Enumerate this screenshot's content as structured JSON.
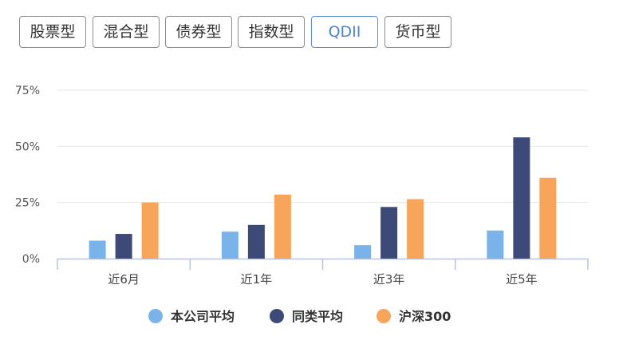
{
  "tabs": [
    {
      "label": "股票型",
      "active": false
    },
    {
      "label": "混合型",
      "active": false
    },
    {
      "label": "债券型",
      "active": false
    },
    {
      "label": "指数型",
      "active": false
    },
    {
      "label": "QDII",
      "active": true
    },
    {
      "label": "货币型",
      "active": false
    }
  ],
  "chart_data": {
    "type": "bar",
    "categories": [
      "近6月",
      "近1年",
      "近3年",
      "近5年"
    ],
    "yticks": [
      "0%",
      "25%",
      "50%",
      "75%"
    ],
    "ylim": [
      0,
      75
    ],
    "grid": true,
    "legend_position": "bottom",
    "series": [
      {
        "name": "本公司平均",
        "color": "#7ab3ea",
        "values": [
          8,
          12,
          6,
          12.5
        ]
      },
      {
        "name": "同类平均",
        "color": "#3d4a78",
        "values": [
          11,
          15,
          23,
          54
        ]
      },
      {
        "name": "沪深300",
        "color": "#f7a55b",
        "values": [
          25,
          28.5,
          26.5,
          36
        ]
      }
    ]
  }
}
